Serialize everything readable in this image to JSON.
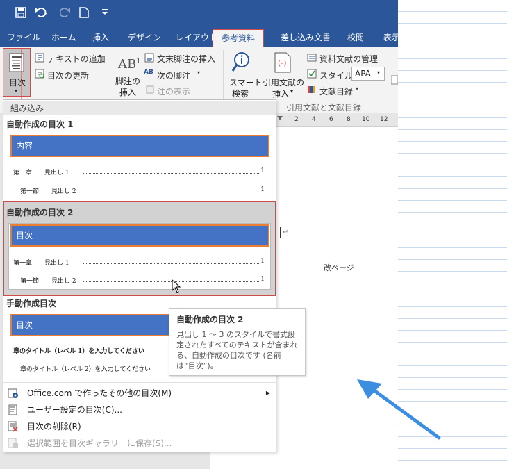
{
  "qat": {
    "save_icon": "save-icon",
    "undo_icon": "undo-icon",
    "redo_icon": "redo-icon",
    "new_icon": "new-doc-icon",
    "customize_icon": "customize-icon"
  },
  "tabs": [
    "ファイル",
    "ホーム",
    "挿入",
    "デザイン",
    "レイアウト",
    "参考資料",
    "差し込み文書",
    "校閲",
    "表示"
  ],
  "ribbon": {
    "toc_label": "目次",
    "add_text": "テキストの追加",
    "update_toc": "目次の更新",
    "footnote_label1": "脚注の",
    "footnote_label2": "挿入",
    "endnote": "文末脚注の挿入",
    "next_footnote": "次の脚注",
    "show_notes": "注の表示",
    "smart1": "スマート",
    "smart2": "検索",
    "citation1": "引用文献の",
    "citation2": "挿入",
    "manage_sources": "資料文献の管理",
    "style_label": "スタイル:",
    "style_value": "APA",
    "bibliography": "文献目録",
    "group_caption": "引用文献と文献目録",
    "ab_glyph": "AB",
    "ab_sup": "1",
    "ab_small": "AB"
  },
  "ruler": {
    "ticks": [
      "2",
      "4",
      "6",
      "8",
      "10",
      "12"
    ]
  },
  "document": {
    "page_break": "改ページ"
  },
  "dropdown": {
    "section_builtin": "組み込み",
    "auto1": {
      "title": "自動作成の目次 1",
      "heading": "内容",
      "line1_label": "第一章　　見出し 1",
      "line1_page": "1",
      "line2_label": "第一節　　見出し 2",
      "line2_page": "1"
    },
    "auto2": {
      "title": "自動作成の目次 2",
      "heading": "目次",
      "line1_label": "第一章　　見出し 1",
      "line1_page": "1",
      "line2_label": "第一節　　見出し 2",
      "line2_page": "1"
    },
    "manual": {
      "title": "手動作成目次",
      "heading": "目次",
      "line1_label": "章のタイトル（レベル 1）を入力してください",
      "line2_label": "章のタイトル（レベル 2）を入力してください"
    },
    "menu": [
      {
        "label": "Office.com で作ったその他の目次(M)",
        "icon": "office-icon",
        "disabled": false
      },
      {
        "label": "ユーザー設定の目次(C)...",
        "icon": "custom-toc-icon",
        "disabled": false
      },
      {
        "label": "目次の削除(R)",
        "icon": "delete-toc-icon",
        "disabled": false
      },
      {
        "label": "選択範囲を目次ギャラリーに保存(S)...",
        "icon": "save-gallery-icon",
        "disabled": true
      }
    ]
  },
  "tooltip": {
    "title": "自動作成の目次 2",
    "body": "見出し 1 ～ 3 のスタイルで書式設定されたすべてのテキストが含まれる、自動作成の目次です (名前は“目次”)。"
  },
  "colors": {
    "ribbon_blue": "#2b579a",
    "toc_blue": "#4472c4",
    "toc_border": "#ed7d31",
    "highlight_red": "#d04a4a",
    "annotation_arrow": "#3b8ee0"
  }
}
